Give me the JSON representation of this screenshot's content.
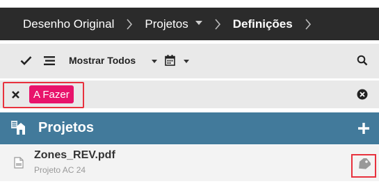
{
  "breadcrumb": {
    "items": [
      {
        "label": "Desenho Original"
      },
      {
        "label": "Projetos"
      },
      {
        "label": "Definições"
      }
    ]
  },
  "toolbar": {
    "show_all_label": "Mostrar Todos"
  },
  "filter": {
    "tag_label": "A Fazer",
    "tag_color": "#e8136b"
  },
  "section": {
    "title": "Projetos",
    "color": "#427a9b"
  },
  "files": [
    {
      "name": "Zones_REV.pdf",
      "subtitle": "Projeto AC 24"
    }
  ],
  "icons": {
    "check": "check-icon",
    "list": "list-icon",
    "calendar": "calendar-icon",
    "search": "search-icon",
    "close": "close-icon",
    "clear": "clear-circle-icon",
    "projects": "projects-icon",
    "add": "plus-icon",
    "pdf": "pdf-file-icon",
    "tag": "tag-icon"
  },
  "colors": {
    "highlight": "#e8313d",
    "dark_bar": "#2b2b2b"
  }
}
